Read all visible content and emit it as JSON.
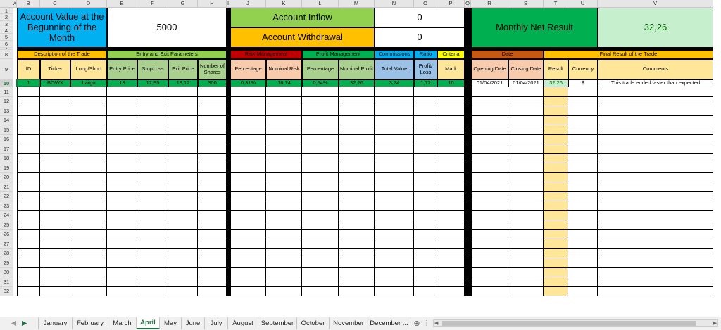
{
  "columns": [
    "A",
    "B",
    "C",
    "D",
    "E",
    "F",
    "G",
    "H",
    "I",
    "J",
    "K",
    "L",
    "M",
    "N",
    "O",
    "P",
    "Q",
    "R",
    "S",
    "T",
    "U",
    "V"
  ],
  "header_block": {
    "account_value_label": "Account Value at the Begunning of the Month",
    "account_value": "5000",
    "account_inflow_label": "Account Inflow",
    "account_inflow": "0",
    "account_withdrawal_label": "Account Withdrawal",
    "account_withdrawal": "0",
    "monthly_net_label": "Monthly Net Result",
    "monthly_net_value": "32,26"
  },
  "groups": {
    "description": "Description of the Trade",
    "entry_exit": "Entry and Exit Parameters",
    "risk": "Risk Management",
    "profit": "Profit Management",
    "commissions": "Commissions",
    "ratio": "Ratio",
    "criteria": "Criteria",
    "date": "Date",
    "final": "Final Result of the Trade"
  },
  "table_headers": [
    "ID",
    "Ticker",
    "Long/Short",
    "Entry Price",
    "StopLoss",
    "Exit Price",
    "Number of Shares",
    "Percentage",
    "Nominal Risk",
    "Percentage",
    "Nominal Profit",
    "Total Value",
    "Profit/ Loss",
    "Mark",
    "Opening Date",
    "Closing Date",
    "Result",
    "Currency",
    "Comments"
  ],
  "trade_row": [
    "1",
    "BOWX",
    "Largo",
    "13",
    "12,95",
    "13,12",
    "300",
    "0,31%",
    "18,74",
    "0,54%",
    "32,26",
    "3,74",
    "1,72",
    "10",
    "01/04/2021",
    "01/04/2021",
    "32,26",
    "$",
    "This trade ended faster than expected"
  ],
  "sheet_tabs": [
    "January",
    "February",
    "March",
    "April",
    "May",
    "June",
    "July",
    "August",
    "September",
    "October",
    "November",
    "December ..."
  ],
  "active_tab": "April",
  "colors": {
    "blue": "#00b0f0",
    "green": "#92d050",
    "orange": "#ffc000",
    "dark_green": "#00b050",
    "light_green": "#c6efce",
    "risk_red": "#c00000",
    "salmon": "#f8cbad",
    "light_green_hdr": "#a9d08e",
    "light_blue": "#9bc2e6",
    "light_yellow": "#ffe699",
    "yellow": "#ffff00",
    "brown": "#c65911",
    "row_green": "#00b050",
    "result_fill": "#ffe699"
  }
}
